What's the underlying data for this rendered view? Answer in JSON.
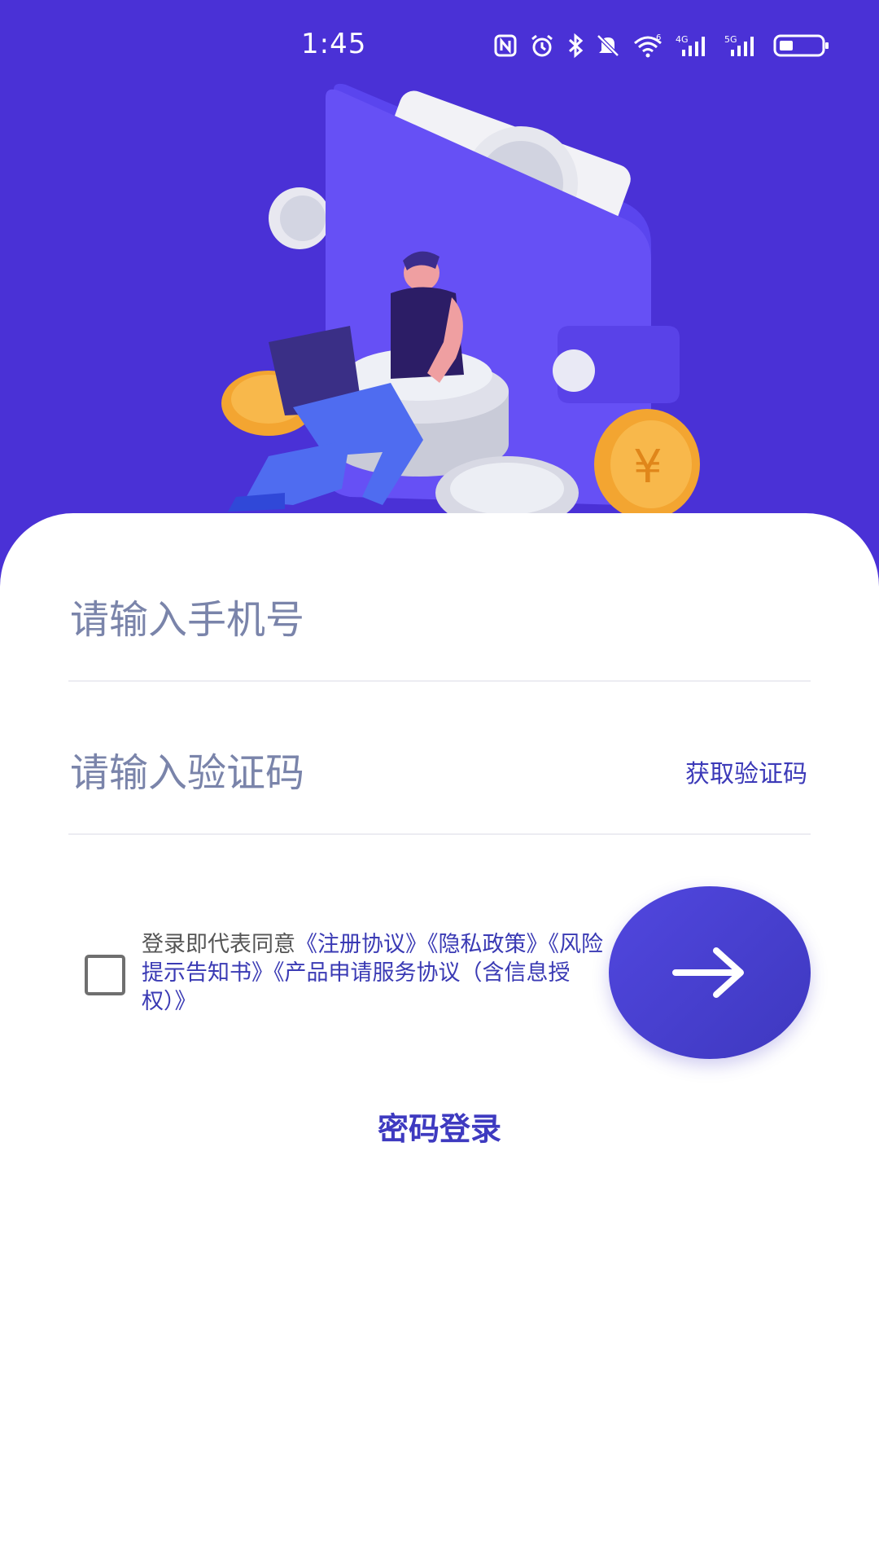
{
  "status_bar": {
    "time": "1:45",
    "icons": [
      "nfc-icon",
      "alarm-icon",
      "bluetooth-icon",
      "mute-icon",
      "wifi-icon",
      "signal-4g-icon",
      "signal-5g-icon",
      "battery-icon"
    ],
    "wifi_label": "6",
    "signal1_label": "4G",
    "signal2_label": "5G"
  },
  "login": {
    "phone_placeholder": "请输入手机号",
    "code_placeholder": "请输入验证码",
    "get_code_label": "获取验证码",
    "agreement_prefix": "登录即代表同意",
    "agreement_links": [
      "《注册协议》",
      "《隐私政策》",
      "《风险提示告知书》",
      "《产品申请服务协议（含信息授权）》"
    ],
    "password_login_label": "密码登录"
  },
  "colors": {
    "hero_bg": "#4a31d6",
    "accent": "#3e3ac0",
    "placeholder": "#7a84aa"
  }
}
